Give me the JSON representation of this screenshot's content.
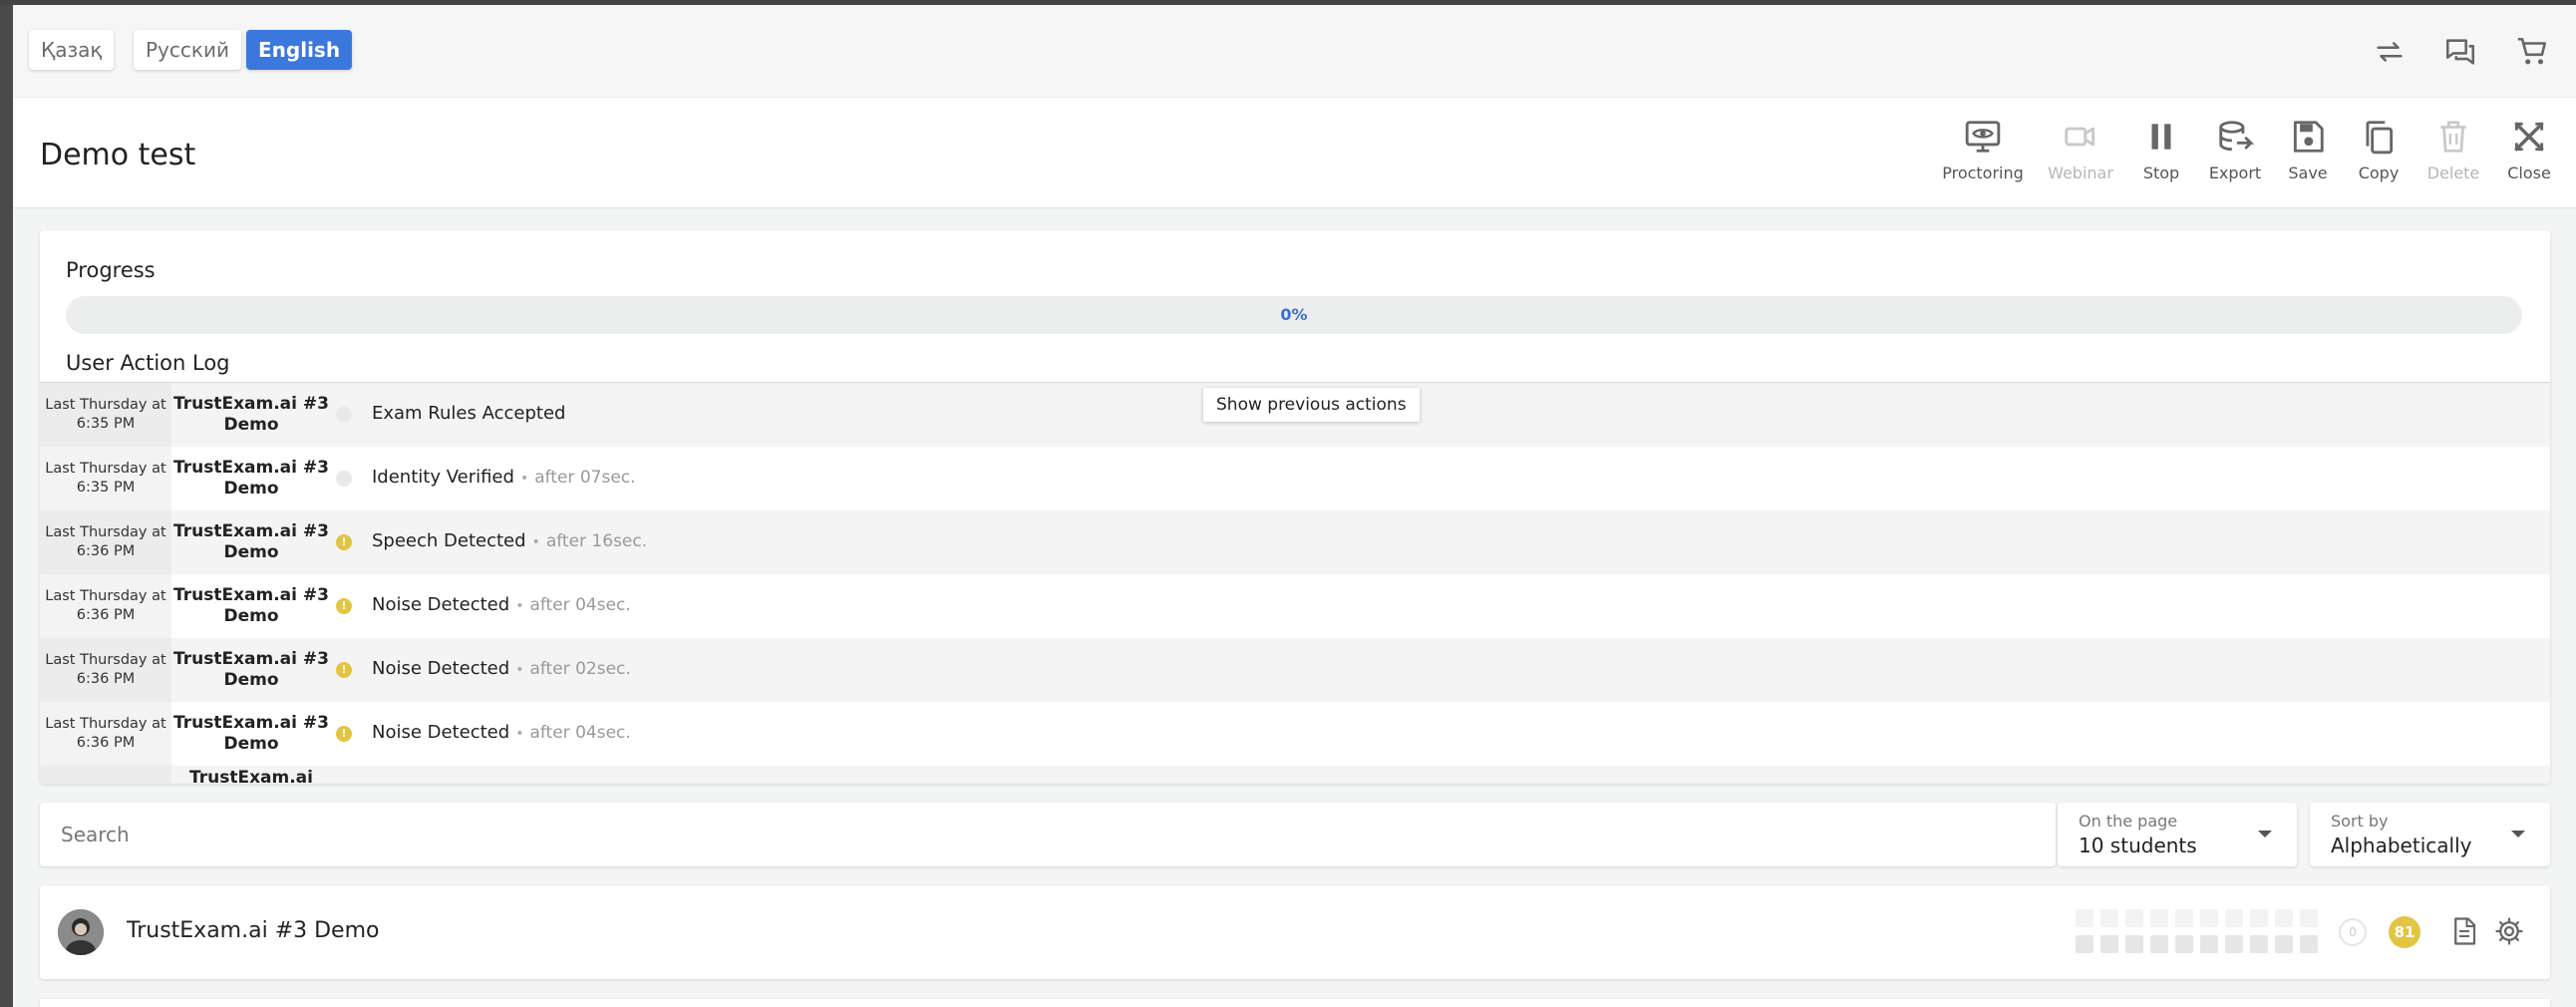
{
  "languages": [
    {
      "label": "Қазақ",
      "active": false
    },
    {
      "label": "Русский",
      "active": false
    },
    {
      "label": "English",
      "active": true
    }
  ],
  "header_icons": [
    "swap-icon",
    "chat-icon",
    "cart-icon"
  ],
  "page": {
    "title": "Demo test"
  },
  "toolbar": [
    {
      "label": "Proctoring",
      "icon": "monitor-eye-icon",
      "disabled": false
    },
    {
      "label": "Webinar",
      "icon": "video-camera-icon",
      "disabled": true
    },
    {
      "label": "Stop",
      "icon": "pause-icon",
      "disabled": false
    },
    {
      "label": "Export",
      "icon": "export-database-icon",
      "disabled": false
    },
    {
      "label": "Save",
      "icon": "floppy-disk-icon",
      "disabled": false
    },
    {
      "label": "Copy",
      "icon": "copy-icon",
      "disabled": false
    },
    {
      "label": "Delete",
      "icon": "trash-icon",
      "disabled": true
    },
    {
      "label": "Close",
      "icon": "close-icon",
      "disabled": false
    }
  ],
  "progress": {
    "heading": "Progress",
    "label": "0%",
    "value": 0
  },
  "log": {
    "heading": "User Action Log",
    "show_previous": "Show previous actions",
    "rows": [
      {
        "time": "Last Thursday at 6:35 PM",
        "user": "TrustExam.ai #3 Demo",
        "status": "neutral",
        "action": "Exam Rules Accepted",
        "after": ""
      },
      {
        "time": "Last Thursday at 6:35 PM",
        "user": "TrustExam.ai #3 Demo",
        "status": "neutral",
        "action": "Identity Verified",
        "after": "after 07sec."
      },
      {
        "time": "Last Thursday at 6:36 PM",
        "user": "TrustExam.ai #3 Demo",
        "status": "warning",
        "action": "Speech Detected",
        "after": "after 16sec."
      },
      {
        "time": "Last Thursday at 6:36 PM",
        "user": "TrustExam.ai #3 Demo",
        "status": "warning",
        "action": "Noise Detected",
        "after": "after 04sec."
      },
      {
        "time": "Last Thursday at 6:36 PM",
        "user": "TrustExam.ai #3 Demo",
        "status": "warning",
        "action": "Noise Detected",
        "after": "after 02sec."
      },
      {
        "time": "Last Thursday at 6:36 PM",
        "user": "TrustExam.ai #3 Demo",
        "status": "warning",
        "action": "Noise Detected",
        "after": "after 04sec."
      },
      {
        "time": "",
        "user": "TrustExam.ai",
        "status": "",
        "action": "",
        "after": ""
      }
    ]
  },
  "search": {
    "placeholder": "Search"
  },
  "per_page": {
    "label": "On the page",
    "value": "10 students"
  },
  "sort": {
    "label": "Sort by",
    "value": "Alphabetically"
  },
  "students": [
    {
      "name": "TrustExam.ai #3 Demo",
      "ring_value": "0",
      "score": "81"
    }
  ],
  "colors": {
    "accent": "#3a78de",
    "warning": "#e2c543"
  }
}
